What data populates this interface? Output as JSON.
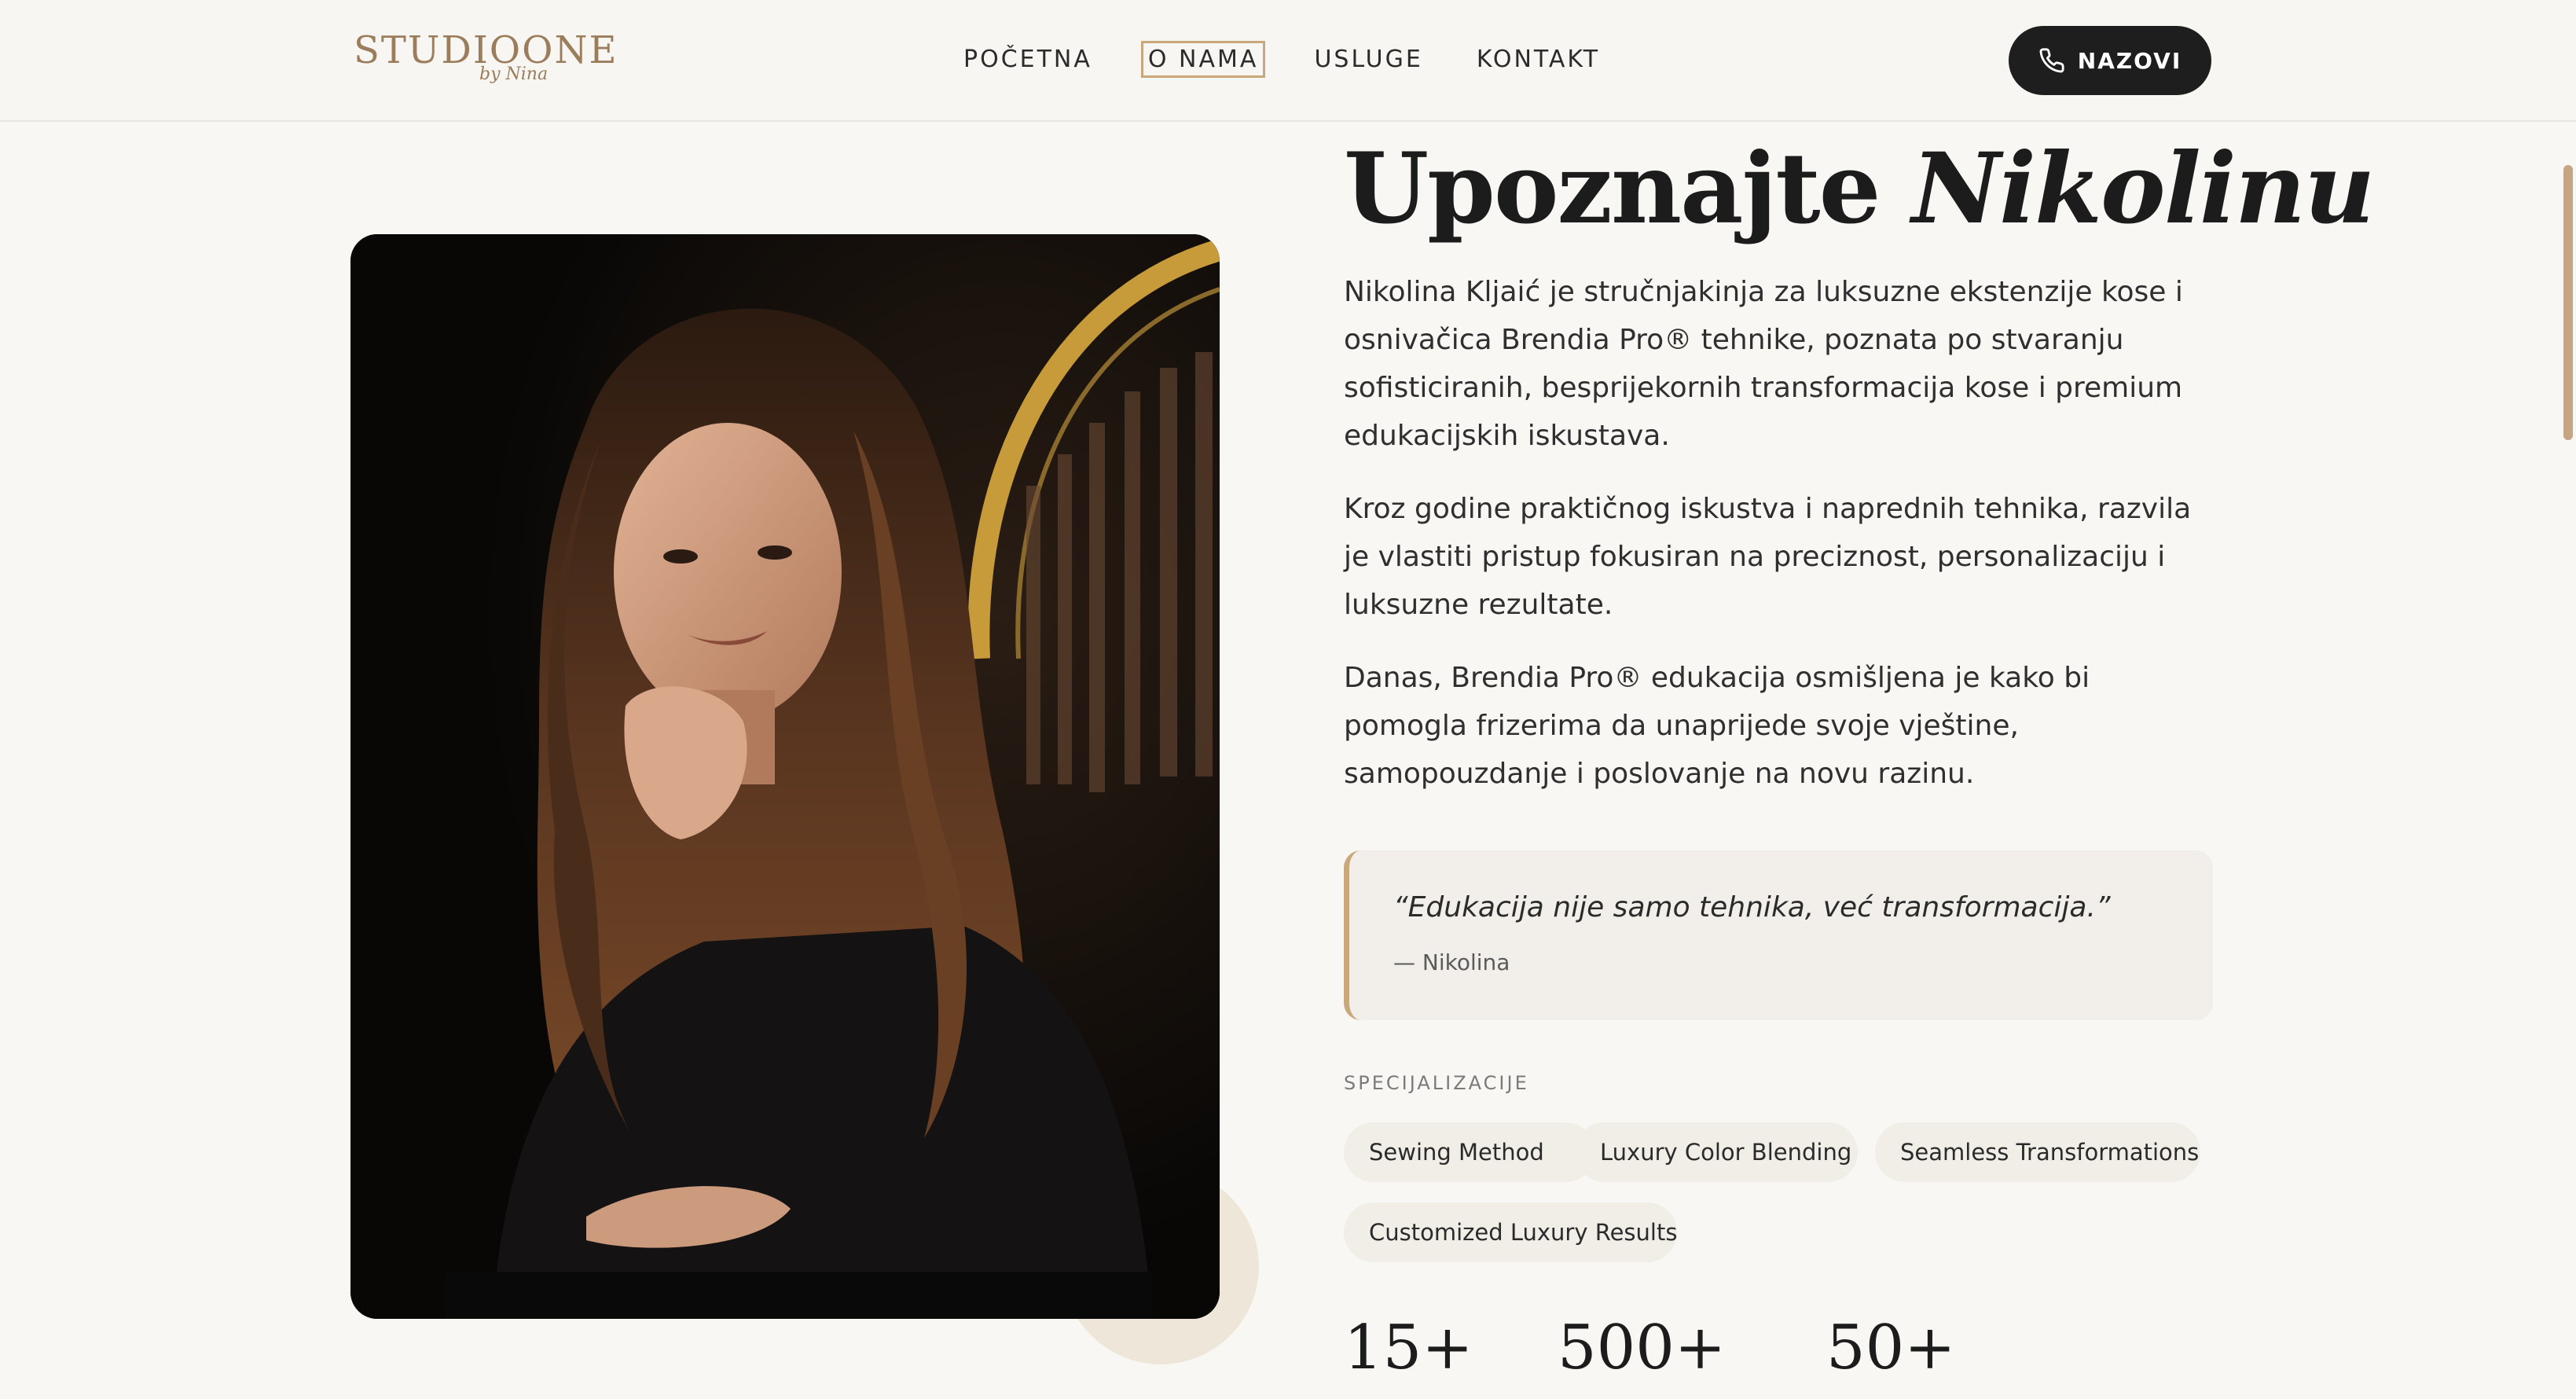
{
  "header": {
    "logo": {
      "main": "STUDIOONE",
      "sub": "by Nina"
    },
    "nav": [
      {
        "label": "POČETNA",
        "active": false
      },
      {
        "label": "O NAMA",
        "active": true
      },
      {
        "label": "USLUGE",
        "active": false
      },
      {
        "label": "KONTAKT",
        "active": false
      }
    ],
    "call_button": {
      "label": "NAZOVI",
      "icon": "phone-icon"
    }
  },
  "about": {
    "heading_plain": "Upoznajte",
    "heading_italic": "Nikolinu",
    "paragraphs": [
      "Nikolina Kljaić je stručnjakinja za luksuzne ekstenzije kose i osnivačica Brendia Pro® tehnike, poznata po stvaranju sofisticiranih, besprijekornih transformacija kose i premium edukacijskih iskustava.",
      "Kroz godine praktičnog iskustva i naprednih tehnika, razvila je vlastiti pristup fokusiran na preciznost, personalizaciju i luksuzne rezultate.",
      "Danas, Brendia Pro® edukacija osmišljena je kako bi pomogla frizerima da unaprijede svoje vještine, samopouzdanje i poslovanje na novu razinu."
    ],
    "quote": {
      "text": "“Edukacija nije samo tehnika, već transformacija.”",
      "author": "— Nikolina"
    },
    "specializations_label": "SPECIJALIZACIJE",
    "specializations": [
      "Sewing Method",
      "Luxury Color Blending",
      "Seamless Transformations",
      "Customized Luxury Results"
    ],
    "stats": [
      "15+",
      "500+",
      "50+"
    ]
  },
  "colors": {
    "accent": "#c9a87c",
    "dark": "#1e1e1e",
    "background": "#f9f7f4"
  }
}
